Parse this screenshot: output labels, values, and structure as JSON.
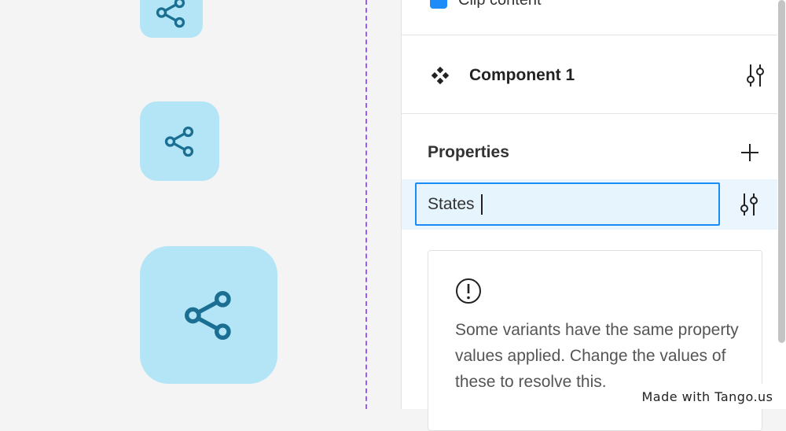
{
  "canvas": {
    "frame_border_color": "#9b5cf6",
    "tile_color": "#b3e5f7",
    "icon_color": "#1b6f92",
    "tiles": [
      {
        "icon": "share-icon"
      },
      {
        "icon": "share-icon"
      },
      {
        "icon": "share-icon"
      }
    ]
  },
  "panel": {
    "clip_content": {
      "label": "Clip content",
      "checked": true,
      "checkbox_color": "#1d8cf8"
    },
    "component": {
      "icon": "component-icon",
      "name": "Component 1",
      "action_icon": "tune-icon"
    },
    "properties": {
      "title": "Properties",
      "add_icon": "plus-icon",
      "items": [
        {
          "value": "States",
          "action_icon": "tune-icon",
          "focus_color": "#1a8cf5"
        }
      ]
    },
    "warning": {
      "icon": "alert-circle-icon",
      "text": "Some variants have the same property values applied. Change the values of these to resolve this."
    }
  },
  "watermark": {
    "text": "Made with Tango.us"
  }
}
